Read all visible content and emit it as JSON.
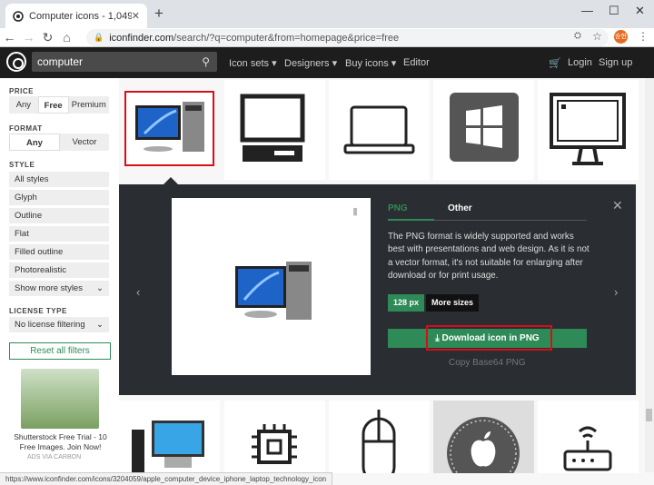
{
  "browser": {
    "tab_title": "Computer icons - 1,049 free &",
    "url_host": "iconfinder.com",
    "url_path": "/search/?q=computer&from=homepage&price=free",
    "profile": "승현"
  },
  "nav": {
    "search_value": "computer",
    "menu": [
      "Icon sets",
      "Designers",
      "Buy icons",
      "Editor"
    ],
    "login": "Login",
    "signup": "Sign up"
  },
  "filters": {
    "price_label": "PRICE",
    "price_options": [
      "Any",
      "Free",
      "Premium"
    ],
    "price_selected": "Free",
    "format_label": "FORMAT",
    "format_options": [
      "Any",
      "Vector"
    ],
    "format_selected": "Any",
    "style_label": "STYLE",
    "styles": [
      "All styles",
      "Glyph",
      "Outline",
      "Flat",
      "Filled outline",
      "Photorealistic",
      "Show more styles"
    ],
    "license_label": "LICENSE TYPE",
    "license_value": "No license filtering",
    "reset": "Reset all filters"
  },
  "ad": {
    "text": "Shutterstock Free Trial - 10 Free Images. Join Now!",
    "via": "ADS VIA CARBON"
  },
  "panel": {
    "tab_png": "PNG",
    "tab_other": "Other",
    "description": "The PNG format is widely supported and works best with presentations and web design. As it is not a vector format, it's not suitable for enlarging after download or for print usage.",
    "size": "128 px",
    "more_sizes": "More sizes",
    "download": "Download icon in PNG",
    "copy_base64": "Copy Base64 PNG"
  },
  "status_url": "https://www.iconfinder.com/icons/3204059/apple_computer_device_iphone_laptop_technology_icon",
  "colors": {
    "accent": "#2e8b57",
    "highlight": "#d50f19",
    "dark_nav": "#1d1d1d",
    "panel": "#2a2d31"
  }
}
